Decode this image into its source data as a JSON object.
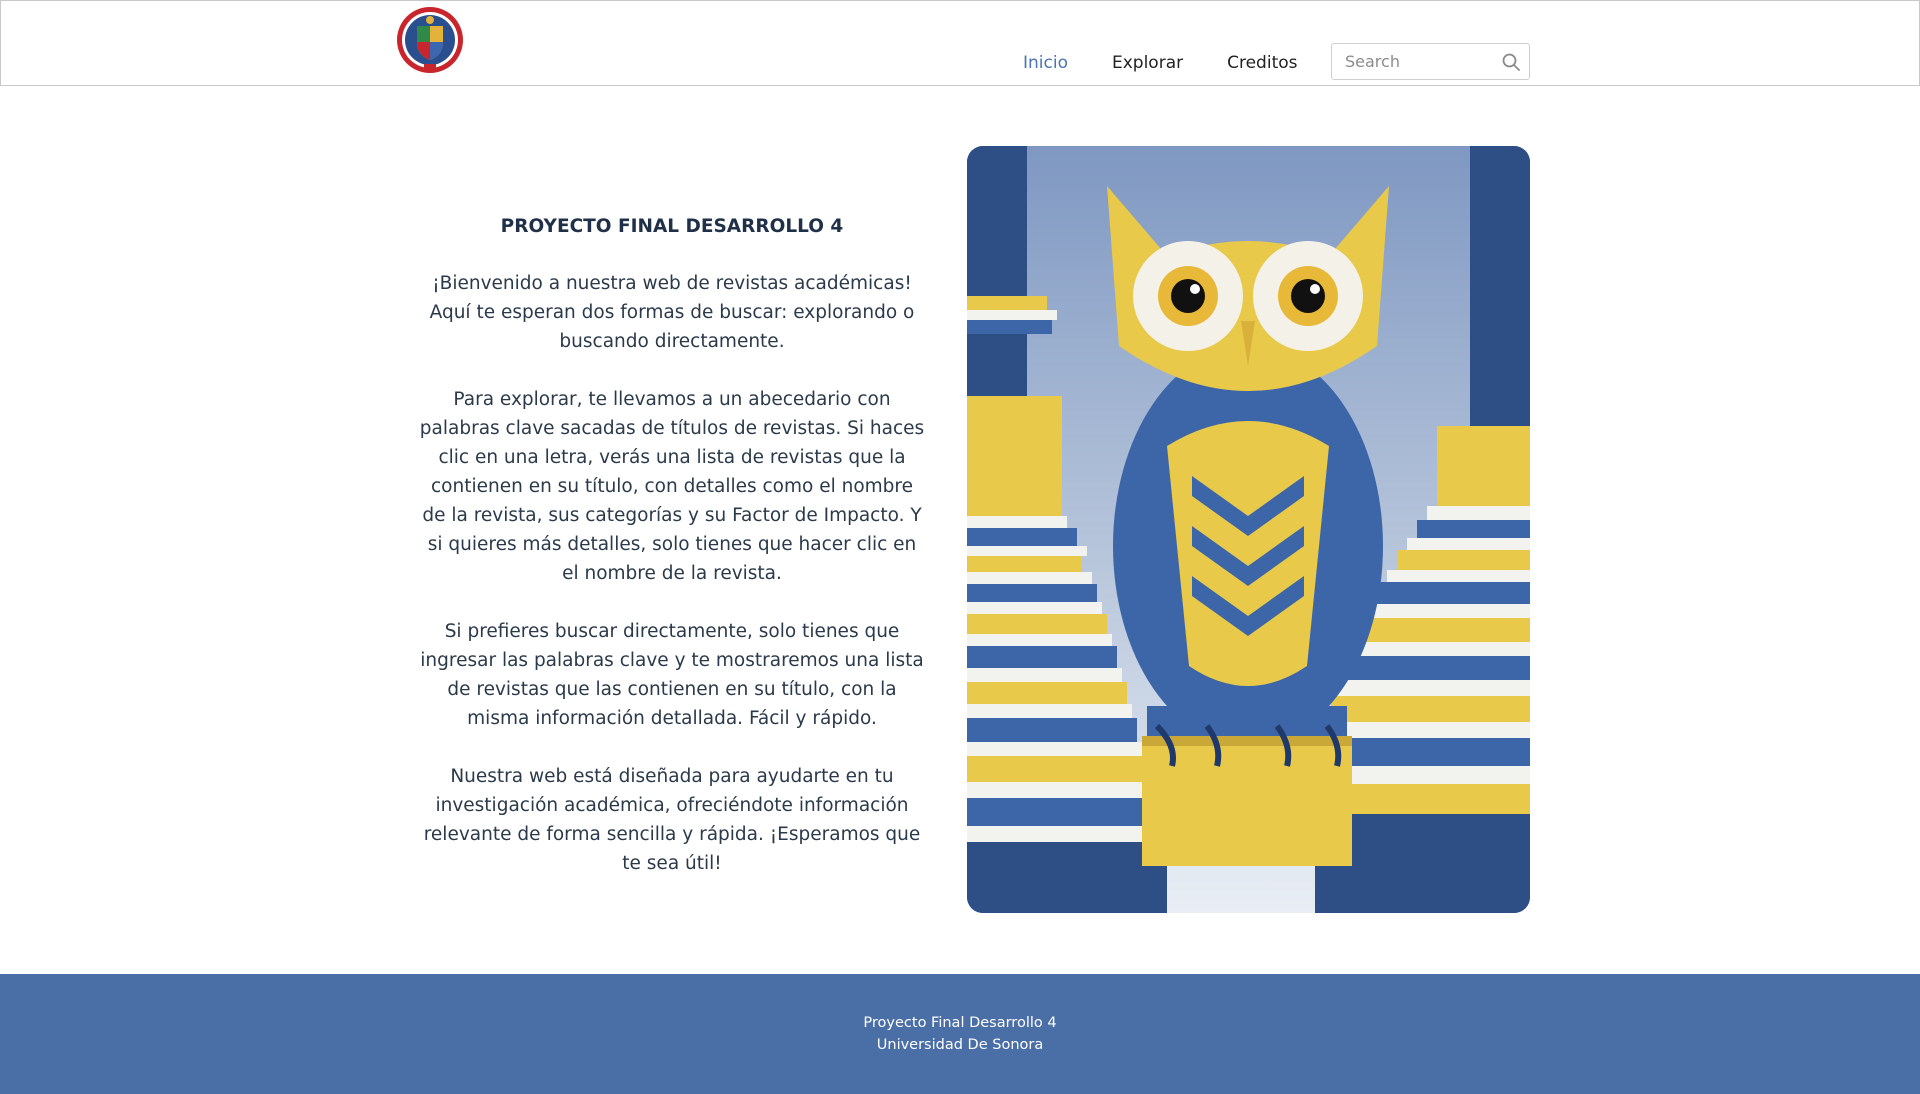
{
  "header": {
    "logo_icon": "university-seal-logo",
    "nav": [
      {
        "label": "Inicio",
        "active": true
      },
      {
        "label": "Explorar",
        "active": false
      },
      {
        "label": "Creditos",
        "active": false
      }
    ],
    "search": {
      "placeholder": "Search",
      "value": "",
      "icon": "search-icon"
    }
  },
  "main": {
    "title": "PROYECTO FINAL DESARROLLO 4",
    "paragraphs": [
      "¡Bienvenido a nuestra web de revistas académicas! Aquí te esperan dos formas de buscar: explorando o buscando directamente.",
      "Para explorar, te llevamos a un abecedario con palabras clave sacadas de títulos de revistas. Si haces clic en una letra, verás una lista de revistas que la contienen en su título, con detalles como el nombre de la revista, sus categorías y su Factor de Impacto. Y si quieres más detalles, solo tienes que hacer clic en el nombre de la revista.",
      "Si prefieres buscar directamente, solo tienes que ingresar las palabras clave y te mostraremos una lista de revistas que las contienen en su título, con la misma información detallada. Fácil y rápido.",
      "Nuestra web está diseñada para ayudarte en tu investigación académica, ofreciéndote información relevante de forma sencilla y rápida. ¡Esperamos que te sea útil!"
    ],
    "hero_image": "owl-on-books-illustration"
  },
  "footer": {
    "line1": "Proyecto Final Desarrollo 4",
    "line2": "Universidad De Sonora"
  },
  "colors": {
    "accent": "#4a74b3",
    "footer_bg": "#4a6ea6",
    "text": "#2b3a4a",
    "owl_yellow": "#e8c94a",
    "owl_blue": "#3d66a8"
  }
}
